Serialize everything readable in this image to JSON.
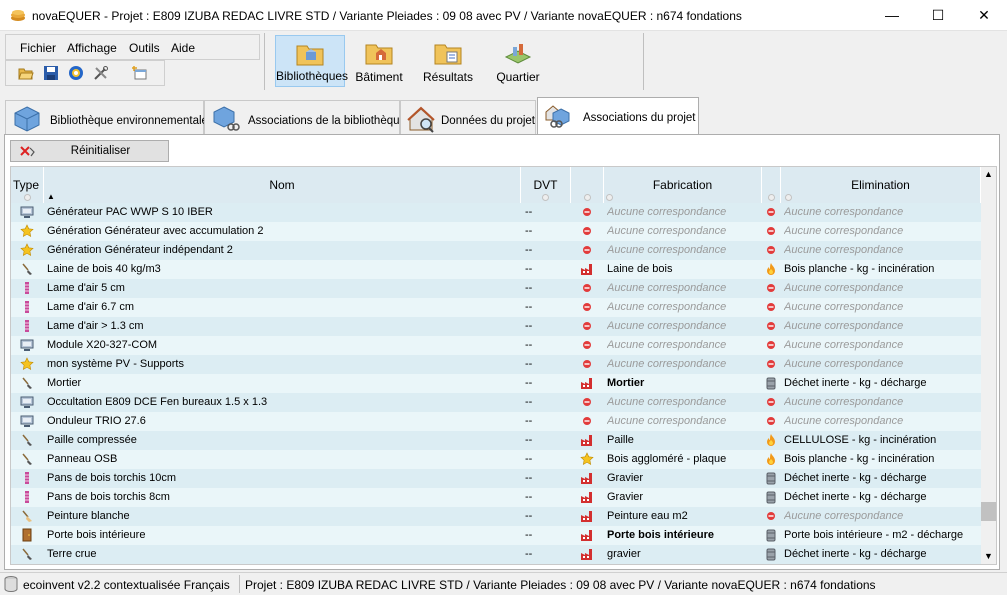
{
  "window": {
    "title": "novaEQUER -  Projet : E809 IZUBA REDAC LIVRE STD / Variante Pleiades : 09 08 avec PV / Variante novaEQUER : n674 fondations",
    "minimize": "—",
    "maximize": "☐",
    "close": "✕"
  },
  "menu": [
    "Fichier",
    "Affichage",
    "Outils",
    "Aide"
  ],
  "ribbon": [
    {
      "label": "Bibliothèques",
      "active": true
    },
    {
      "label": "Bâtiment",
      "active": false
    },
    {
      "label": "Résultats",
      "active": false
    },
    {
      "label": "Quartier",
      "active": false
    }
  ],
  "tabs": [
    {
      "label": "Bibliothèque environnementale"
    },
    {
      "label": "Associations de la bibliothèque"
    },
    {
      "label": "Données du projet"
    },
    {
      "label": "Associations du projet",
      "active": true
    }
  ],
  "reset_label": "Réinitialiser",
  "grid": {
    "headers": {
      "type": "Type",
      "nom": "Nom",
      "dvt": "DVT",
      "fabrication": "Fabrication",
      "elimination": "Elimination"
    },
    "rows": [
      {
        "icon": "monitor-icon",
        "nom": "Générateur PAC WWP S 10 IBER",
        "dvt": "--",
        "fab_icon": "no-entry-icon",
        "fab": "Aucune correspondance",
        "fab_muted": true,
        "fab_bold": false,
        "elim_icon": "no-entry-icon",
        "elim": "Aucune correspondance",
        "elim_muted": true
      },
      {
        "icon": "star-icon",
        "nom": "Génération Générateur avec accumulation 2",
        "dvt": "--",
        "fab_icon": "no-entry-icon",
        "fab": "Aucune correspondance",
        "fab_muted": true,
        "fab_bold": false,
        "elim_icon": "no-entry-icon",
        "elim": "Aucune correspondance",
        "elim_muted": true
      },
      {
        "icon": "star-icon",
        "nom": "Génération Générateur indépendant 2",
        "dvt": "--",
        "fab_icon": "no-entry-icon",
        "fab": "Aucune correspondance",
        "fab_muted": true,
        "fab_bold": false,
        "elim_icon": "no-entry-icon",
        "elim": "Aucune correspondance",
        "elim_muted": true
      },
      {
        "icon": "trowel-icon",
        "nom": "Laine de bois 40 kg/m3",
        "dvt": "--",
        "fab_icon": "factory-icon",
        "fab": "Laine de bois",
        "fab_muted": false,
        "fab_bold": false,
        "elim_icon": "fire-icon",
        "elim": "Bois planche - kg - incinération",
        "elim_muted": false
      },
      {
        "icon": "air-layer-icon",
        "nom": "Lame d'air 5 cm",
        "dvt": "--",
        "fab_icon": "no-entry-icon",
        "fab": "Aucune correspondance",
        "fab_muted": true,
        "fab_bold": false,
        "elim_icon": "no-entry-icon",
        "elim": "Aucune correspondance",
        "elim_muted": true
      },
      {
        "icon": "air-layer-icon",
        "nom": "Lame d'air 6.7 cm",
        "dvt": "--",
        "fab_icon": "no-entry-icon",
        "fab": "Aucune correspondance",
        "fab_muted": true,
        "fab_bold": false,
        "elim_icon": "no-entry-icon",
        "elim": "Aucune correspondance",
        "elim_muted": true
      },
      {
        "icon": "air-layer-icon",
        "nom": "Lame d'air > 1.3 cm",
        "dvt": "--",
        "fab_icon": "no-entry-icon",
        "fab": "Aucune correspondance",
        "fab_muted": true,
        "fab_bold": false,
        "elim_icon": "no-entry-icon",
        "elim": "Aucune correspondance",
        "elim_muted": true
      },
      {
        "icon": "monitor-icon",
        "nom": "Module X20-327-COM",
        "dvt": "--",
        "fab_icon": "no-entry-icon",
        "fab": "Aucune correspondance",
        "fab_muted": true,
        "fab_bold": false,
        "elim_icon": "no-entry-icon",
        "elim": "Aucune correspondance",
        "elim_muted": true
      },
      {
        "icon": "star-icon",
        "nom": "mon système PV - Supports",
        "dvt": "--",
        "fab_icon": "no-entry-icon",
        "fab": "Aucune correspondance",
        "fab_muted": true,
        "fab_bold": false,
        "elim_icon": "no-entry-icon",
        "elim": "Aucune correspondance",
        "elim_muted": true
      },
      {
        "icon": "trowel-icon",
        "nom": "Mortier",
        "dvt": "--",
        "fab_icon": "factory-icon",
        "fab": "Mortier",
        "fab_muted": false,
        "fab_bold": true,
        "elim_icon": "barrel-icon",
        "elim": "Déchet inerte - kg - décharge",
        "elim_muted": false
      },
      {
        "icon": "monitor-icon",
        "nom": "Occultation E809 DCE Fen bureaux 1.5 x 1.3",
        "dvt": "--",
        "fab_icon": "no-entry-icon",
        "fab": "Aucune correspondance",
        "fab_muted": true,
        "fab_bold": false,
        "elim_icon": "no-entry-icon",
        "elim": "Aucune correspondance",
        "elim_muted": true
      },
      {
        "icon": "monitor-icon",
        "nom": "Onduleur TRIO 27.6",
        "dvt": "--",
        "fab_icon": "no-entry-icon",
        "fab": "Aucune correspondance",
        "fab_muted": true,
        "fab_bold": false,
        "elim_icon": "no-entry-icon",
        "elim": "Aucune correspondance",
        "elim_muted": true
      },
      {
        "icon": "trowel-icon",
        "nom": "Paille compressée",
        "dvt": "--",
        "fab_icon": "factory-icon",
        "fab": "Paille",
        "fab_muted": false,
        "fab_bold": false,
        "elim_icon": "fire-icon",
        "elim": "CELLULOSE - kg - incinération",
        "elim_muted": false
      },
      {
        "icon": "trowel-icon",
        "nom": "Panneau OSB",
        "dvt": "--",
        "fab_icon": "star-icon",
        "fab": "Bois aggloméré - plaque",
        "fab_muted": false,
        "fab_bold": false,
        "elim_icon": "fire-icon",
        "elim": "Bois planche - kg - incinération",
        "elim_muted": false
      },
      {
        "icon": "air-layer-icon",
        "nom": "Pans de bois torchis 10cm",
        "dvt": "--",
        "fab_icon": "factory-icon",
        "fab": "Gravier",
        "fab_muted": false,
        "fab_bold": false,
        "elim_icon": "barrel-icon",
        "elim": "Déchet inerte - kg - décharge",
        "elim_muted": false
      },
      {
        "icon": "air-layer-icon",
        "nom": "Pans de bois torchis 8cm",
        "dvt": "--",
        "fab_icon": "factory-icon",
        "fab": "Gravier",
        "fab_muted": false,
        "fab_bold": false,
        "elim_icon": "barrel-icon",
        "elim": "Déchet inerte - kg - décharge",
        "elim_muted": false
      },
      {
        "icon": "paint-brush-icon",
        "nom": "Peinture blanche",
        "dvt": "--",
        "fab_icon": "factory-icon",
        "fab": "Peinture eau m2",
        "fab_muted": false,
        "fab_bold": false,
        "elim_icon": "no-entry-icon",
        "elim": "Aucune correspondance",
        "elim_muted": true
      },
      {
        "icon": "door-icon",
        "nom": "Porte bois intérieure",
        "dvt": "--",
        "fab_icon": "factory-icon",
        "fab": "Porte bois intérieure",
        "fab_muted": false,
        "fab_bold": true,
        "elim_icon": "barrel-icon",
        "elim": "Porte bois intérieure - m2 - décharge",
        "elim_muted": false
      },
      {
        "icon": "trowel-icon",
        "nom": "Terre crue",
        "dvt": "--",
        "fab_icon": "factory-icon",
        "fab": "gravier",
        "fab_muted": false,
        "fab_bold": false,
        "elim_icon": "barrel-icon",
        "elim": "Déchet inerte - kg - décharge",
        "elim_muted": false
      }
    ]
  },
  "status": {
    "database": "ecoinvent v2.2 contextualisée Français",
    "project": "Projet : E809 IZUBA REDAC LIVRE STD / Variante Pleiades : 09 08 avec PV / Variante novaEQUER : n674 fondations"
  },
  "colors": {
    "row_even": "#dcedf3",
    "row_odd": "#eaf6f9",
    "header": "#dceaf1",
    "active_ribbon": "#cce4f7"
  }
}
